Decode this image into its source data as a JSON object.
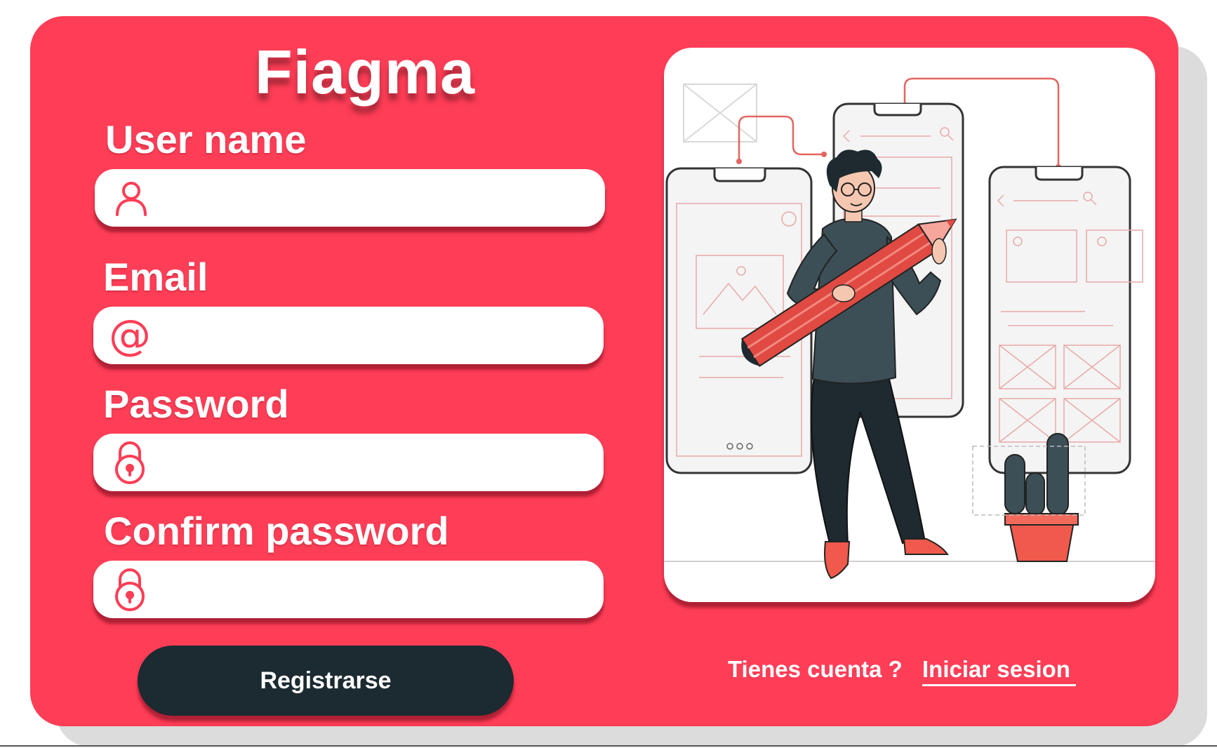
{
  "brand": {
    "title": "Fiagma"
  },
  "form": {
    "username": {
      "label": "User name",
      "value": "",
      "placeholder": "",
      "icon": "user-icon"
    },
    "email": {
      "label": "Email",
      "value": "",
      "placeholder": "",
      "icon": "at-sign-icon",
      "glyph": "@"
    },
    "password": {
      "label": "Password",
      "value": "",
      "placeholder": "",
      "icon": "lock-icon"
    },
    "confirm_password": {
      "label": "Confirm password",
      "value": "",
      "placeholder": "",
      "icon": "lock-icon"
    },
    "submit_label": "Registrarse"
  },
  "footer": {
    "question": "Tienes cuenta ?",
    "login_link": "Iniciar sesion"
  },
  "colors": {
    "background": "#ffffff",
    "card": "#fe3d56",
    "button": "#1c2a31",
    "icon_accent": "#fe3d56",
    "text_light": "#ffffff"
  }
}
